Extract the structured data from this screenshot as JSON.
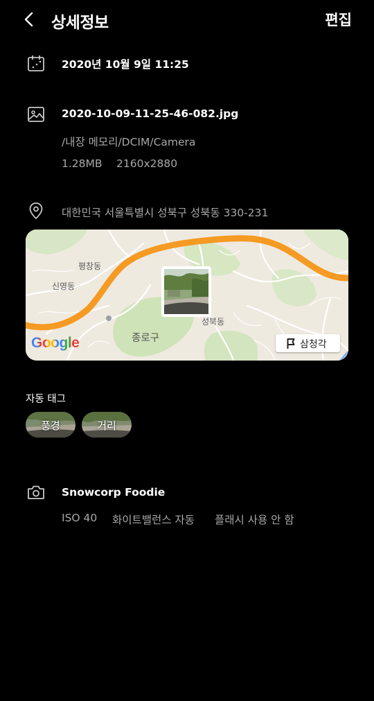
{
  "header": {
    "back_icon": "chevron-left-icon",
    "title": "상세정보",
    "edit_label": "편집"
  },
  "date": {
    "icon": "calendar-icon",
    "value": "2020년 10월 9일 11:25"
  },
  "file": {
    "icon": "image-icon",
    "name": "2020-10-09-11-25-46-082.jpg",
    "path": "/내장 메모리/DCIM/Camera",
    "size": "1.28MB",
    "resolution": "2160x2880"
  },
  "location": {
    "icon": "location-pin-icon",
    "address": "대한민국 서울특별시 성북구 성북동 330-231",
    "map": {
      "labels": [
        "평창동",
        "신영동",
        "종로구",
        "성북동"
      ],
      "google_logo": "Google",
      "street_view_icon": "flag-icon",
      "street_view_label": "삼청각"
    }
  },
  "tags": {
    "title": "자동 태그",
    "items": [
      "풍경",
      "거리"
    ]
  },
  "camera": {
    "icon": "camera-icon",
    "model": "Snowcorp Foodie",
    "iso": "ISO 40",
    "white_balance": "화이트밸런스 자동",
    "flash": "플래시 사용 안 함"
  },
  "colors": {
    "background": "#000000",
    "text_primary": "#ffffff",
    "text_secondary": "#a8a8a8",
    "map_road": "#f59a23"
  }
}
